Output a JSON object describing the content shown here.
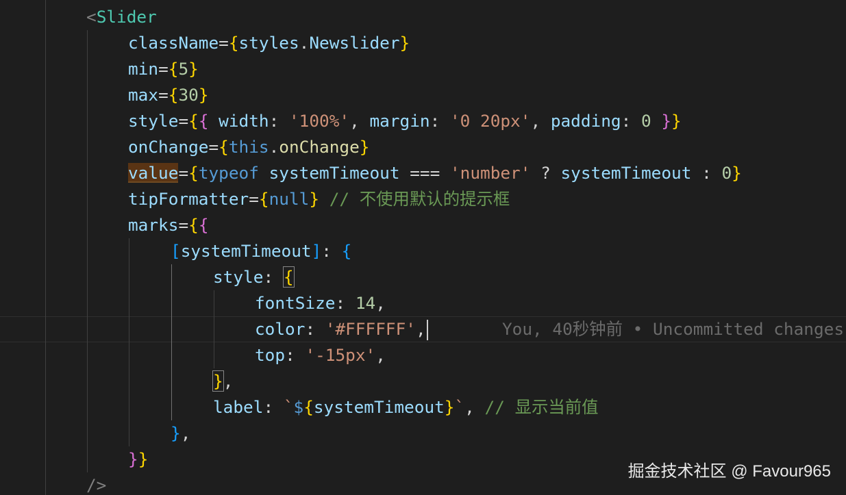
{
  "code": {
    "line_slider_open": {
      "open": "<",
      "tag": "Slider"
    },
    "line_classname": {
      "attr": "className",
      "eq": "=",
      "ob": "{",
      "obj": "styles",
      "dot": ".",
      "prop": "Newslider",
      "cb": "}"
    },
    "line_min": {
      "attr": "min",
      "eq": "=",
      "ob": "{",
      "val": "5",
      "cb": "}"
    },
    "line_max": {
      "attr": "max",
      "eq": "=",
      "ob": "{",
      "val": "30",
      "cb": "}"
    },
    "line_style": {
      "attr": "style",
      "eq": "=",
      "ob1": "{",
      "ob2": "{",
      "k1": " width",
      "c1": ": ",
      "v1": "'100%'",
      "s1": ", ",
      "k2": "margin",
      "c2": ": ",
      "v2": "'0 20px'",
      "s2": ", ",
      "k3": "padding",
      "c3": ": ",
      "v3": "0",
      "sp": " ",
      "cb2": "}",
      "cb1": "}"
    },
    "line_onchange": {
      "attr": "onChange",
      "eq": "=",
      "ob": "{",
      "kw": "this",
      "dot": ".",
      "fn": "onChange",
      "cb": "}"
    },
    "line_value": {
      "attr": "value",
      "eq": "=",
      "ob": "{",
      "kw": "typeof",
      "sp1": " ",
      "var1": "systemTimeout",
      "op": " === ",
      "str": "'number'",
      "q": " ? ",
      "var2": "systemTimeout",
      "col": " : ",
      "num": "0",
      "cb": "}"
    },
    "line_tip": {
      "attr": "tipFormatter",
      "eq": "=",
      "ob": "{",
      "kw": "null",
      "cb": "}",
      "comment": " // 不使用默认的提示框"
    },
    "line_marks": {
      "attr": "marks",
      "eq": "=",
      "ob1": "{",
      "ob2": "{"
    },
    "line_key": {
      "lb": "[",
      "var": "systemTimeout",
      "rb": "]",
      "col": ": ",
      "ob": "{"
    },
    "line_style_key": {
      "key": "style",
      "col": ": ",
      "ob": "{"
    },
    "line_fontsize": {
      "key": "fontSize",
      "col": ": ",
      "val": "14",
      "comma": ","
    },
    "line_color": {
      "key": "color",
      "col": ": ",
      "val": "'#FFFFFF'",
      "comma": ","
    },
    "line_top": {
      "key": "top",
      "col": ": ",
      "val": "'-15px'",
      "comma": ","
    },
    "line_style_close": {
      "cb": "}",
      "comma": ","
    },
    "line_label": {
      "key": "label",
      "col": ": ",
      "tick1": "`",
      "dollar": "$",
      "ob": "{",
      "var": "systemTimeout",
      "cb": "}",
      "tick2": "`",
      "comma": ",",
      "comment": " // 显示当前值"
    },
    "line_key_close": {
      "cb": "}",
      "comma": ","
    },
    "line_marks_close": {
      "cb2": "}",
      "cb1": "}"
    },
    "line_slider_close": {
      "text": "/>"
    }
  },
  "blame": {
    "text": "You, 40秒钟前 • Uncommitted changes"
  },
  "watermark": {
    "text": "掘金技术社区 @ Favour965"
  },
  "theme": {
    "background": "#1e1e1e",
    "tag": "#4ec9b0",
    "attribute": "#9cdcfe",
    "string": "#ce9178",
    "number": "#b5cea8",
    "keyword": "#569cd6",
    "function": "#dcdcaa",
    "comment": "#6a9955",
    "bracket_gold": "#ffd700",
    "bracket_orchid": "#da70d6",
    "bracket_blue": "#179fff"
  }
}
